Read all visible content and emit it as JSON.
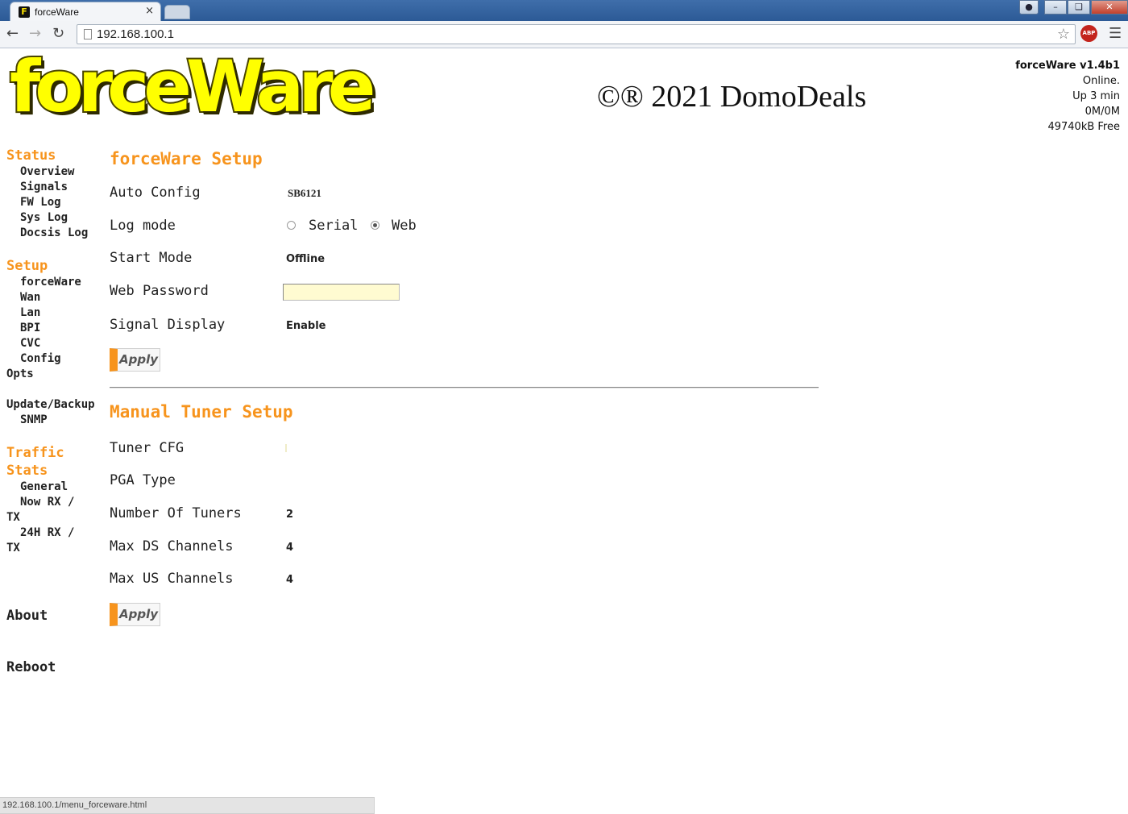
{
  "browser": {
    "tab_title": "forceWare",
    "tab_close": "×",
    "favicon_letter": "F",
    "url": "192.168.100.1",
    "status_url": "192.168.100.1/menu_forceware.html",
    "abp_label": "ABP"
  },
  "header": {
    "logo_text": "forceWare",
    "copyright": "©® 2021 DomoDeals",
    "version": "forceWare v1.4b1",
    "online": "Online.",
    "uptime": "Up 3 min",
    "traffic": "0M/0M",
    "free_mem": "49740kB Free"
  },
  "sidebar": {
    "status": {
      "heading": "Status",
      "items": [
        "Overview",
        "Signals",
        "FW Log",
        "Sys Log",
        "Docsis Log"
      ]
    },
    "setup": {
      "heading": "Setup",
      "items": [
        "forceWare",
        "Wan",
        "Lan",
        "BPI",
        "CVC",
        "Config"
      ],
      "opts": "Opts",
      "update_backup": "Update/Backup",
      "snmp": "SNMP"
    },
    "traffic": {
      "heading_line1": "Traffic",
      "heading_line2": "Stats",
      "general": "General",
      "now_line1": "Now RX /",
      "now_line2": "TX",
      "h24_line1": "24H RX /",
      "h24_line2": "TX"
    },
    "about": "About",
    "reboot": "Reboot"
  },
  "forceware_setup": {
    "title": "forceWare Setup",
    "auto_config_label": "Auto Config",
    "auto_config_value": "SB6121",
    "log_mode_label": "Log mode",
    "log_mode_options": [
      "Serial",
      "Web"
    ],
    "log_mode_selected": "Web",
    "start_mode_label": "Start Mode",
    "start_mode_value": "Offline",
    "web_password_label": "Web Password",
    "web_password_value": "",
    "signal_display_label": "Signal Display",
    "signal_display_value": "Enable",
    "apply_label": "Apply"
  },
  "tuner_setup": {
    "title": "Manual Tuner Setup",
    "tuner_cfg_label": "Tuner CFG",
    "pga_type_label": "PGA Type",
    "num_tuners_label": "Number Of Tuners",
    "num_tuners_value": "2",
    "max_ds_label": "Max DS Channels",
    "max_ds_value": "4",
    "max_us_label": "Max US Channels",
    "max_us_value": "4",
    "apply_label": "Apply"
  }
}
